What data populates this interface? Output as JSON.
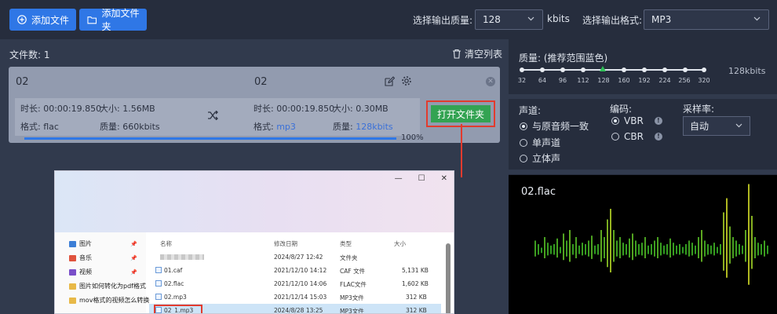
{
  "toolbar": {
    "add_file": "添加文件",
    "add_folder": "添加文件夹",
    "quality_label": "选择输出质量:",
    "quality_value": "128",
    "quality_unit": "kbits",
    "format_label": "选择输出格式:",
    "format_value": "MP3"
  },
  "list": {
    "file_count": "文件数: 1",
    "clear_label": "清空列表"
  },
  "file": {
    "src_name": "02",
    "dst_name": "02",
    "src_duration": "时长: 00:00:19.850",
    "src_size": "大小: 1.56MB",
    "src_format_label": "格式: ",
    "src_format": "flac",
    "src_quality": "质量: 660kbits",
    "dst_duration": "时长: 00:00:19.850",
    "dst_size": "大小: 0.30MB",
    "dst_format_label": "格式: ",
    "dst_format": "mp3",
    "dst_quality_label": "质量: ",
    "dst_quality": "128kbits",
    "open_folder": "打开文件夹",
    "progress_text": "100%",
    "progress": 1.0
  },
  "explorer": {
    "win_controls": [
      "—",
      "☐",
      "✕"
    ],
    "nav": [
      {
        "label": "图片",
        "color": "#3d7fd6",
        "pin": true
      },
      {
        "label": "音乐",
        "color": "#e0533d",
        "pin": true
      },
      {
        "label": "视频",
        "color": "#7a4fc9",
        "pin": true
      },
      {
        "label": "图片如何转化为pdf格式",
        "color": "#e8b948",
        "pin": false
      },
      {
        "label": "mov格式的视频怎么转换",
        "color": "#e8b948",
        "pin": false
      }
    ],
    "columns": {
      "name": "名称",
      "date": "修改日期",
      "type": "类型",
      "size": "大小"
    },
    "files": [
      {
        "name": "",
        "date": "2024/8/27 12:42",
        "type": "文件夹",
        "size": "",
        "blurred": true
      },
      {
        "name": "01.caf",
        "date": "2021/12/10 14:12",
        "type": "CAF 文件",
        "size": "5,131 KB"
      },
      {
        "name": "02.flac",
        "date": "2021/12/10 14:06",
        "type": "FLAC文件",
        "size": "1,602 KB"
      },
      {
        "name": "02.mp3",
        "date": "2021/12/14 15:03",
        "type": "MP3文件",
        "size": "312 KB"
      },
      {
        "name": "02_1.mp3",
        "date": "2024/8/28 13:25",
        "type": "MP3文件",
        "size": "312 KB",
        "selected": true
      }
    ]
  },
  "settings": {
    "quality_title": "质量: (推荐范围蓝色)",
    "ticks": [
      "32",
      "64",
      "96",
      "112",
      "128",
      "160",
      "192",
      "224",
      "256",
      "320"
    ],
    "selected_tick": "128",
    "quality_value": "128kbits",
    "channel_label": "声道:",
    "channels": [
      {
        "label": "与原音频一致",
        "checked": true
      },
      {
        "label": "单声道",
        "checked": false
      },
      {
        "label": "立体声",
        "checked": false
      }
    ],
    "encoding_label": "编码:",
    "encodings": [
      {
        "label": "VBR",
        "checked": true
      },
      {
        "label": "CBR",
        "checked": false
      }
    ],
    "samplerate_label": "采样率:",
    "samplerate_value": "自动"
  },
  "preview": {
    "filename": "02.flac"
  },
  "colors": {
    "accent": "#2f77e6",
    "open_button": "#33a352",
    "highlight_red": "#e23b2e"
  }
}
